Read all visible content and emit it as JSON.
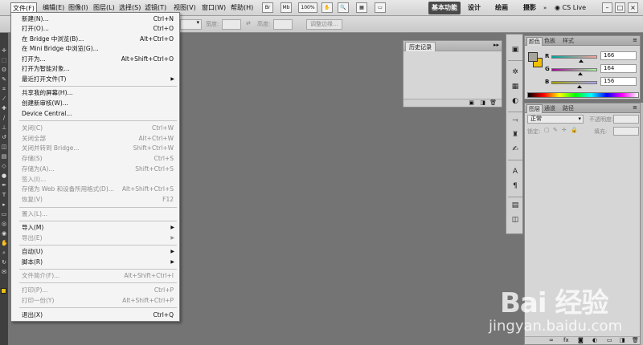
{
  "menubar": {
    "items": [
      "文件(F)",
      "编辑(E)",
      "图像(I)",
      "图层(L)",
      "选择(S)",
      "滤镜(T)",
      "视图(V)",
      "窗口(W)",
      "帮助(H)"
    ],
    "icons": [
      "Br",
      "Mb",
      "100%"
    ],
    "workspaces": [
      "基本功能",
      "设计",
      "绘画",
      "摄影"
    ],
    "cs_live": "CS Live",
    "window_controls": [
      "–",
      "□",
      "×"
    ]
  },
  "options_bar": {
    "width_label": "宽度:",
    "height_label": "高度:",
    "refine_edge": "调整边缘..."
  },
  "file_menu": {
    "items": [
      {
        "label": "新建(N)...",
        "shortcut": "Ctrl+N",
        "disabled": false
      },
      {
        "label": "打开(O)...",
        "shortcut": "Ctrl+O",
        "disabled": false
      },
      {
        "label": "在 Bridge 中浏览(B)...",
        "shortcut": "Alt+Ctrl+O",
        "disabled": false
      },
      {
        "label": "在 Mini Bridge 中浏览(G)...",
        "shortcut": "",
        "disabled": false
      },
      {
        "label": "打开为...",
        "shortcut": "Alt+Shift+Ctrl+O",
        "disabled": false
      },
      {
        "label": "打开为智能对象...",
        "shortcut": "",
        "disabled": false
      },
      {
        "label": "最近打开文件(T)",
        "shortcut": "",
        "disabled": false,
        "submenu": true
      },
      {
        "label": "共享我的屏幕(H)...",
        "shortcut": "",
        "disabled": false
      },
      {
        "label": "创建新审核(W)...",
        "shortcut": "",
        "disabled": false
      },
      {
        "label": "Device Central...",
        "shortcut": "",
        "disabled": false
      },
      {
        "label": "关闭(C)",
        "shortcut": "Ctrl+W",
        "disabled": true
      },
      {
        "label": "关闭全部",
        "shortcut": "Alt+Ctrl+W",
        "disabled": true
      },
      {
        "label": "关闭并转到 Bridge...",
        "shortcut": "Shift+Ctrl+W",
        "disabled": true
      },
      {
        "label": "存储(S)",
        "shortcut": "Ctrl+S",
        "disabled": true
      },
      {
        "label": "存储为(A)...",
        "shortcut": "Shift+Ctrl+S",
        "disabled": true
      },
      {
        "label": "签入(I)...",
        "shortcut": "",
        "disabled": true
      },
      {
        "label": "存储为 Web 和设备所用格式(D)...",
        "shortcut": "Alt+Shift+Ctrl+S",
        "disabled": true
      },
      {
        "label": "恢复(V)",
        "shortcut": "F12",
        "disabled": true
      },
      {
        "label": "置入(L)...",
        "shortcut": "",
        "disabled": true
      },
      {
        "label": "导入(M)",
        "shortcut": "",
        "disabled": false,
        "submenu": true
      },
      {
        "label": "导出(E)",
        "shortcut": "",
        "disabled": true,
        "submenu": true
      },
      {
        "label": "自动(U)",
        "shortcut": "",
        "disabled": false,
        "submenu": true
      },
      {
        "label": "脚本(R)",
        "shortcut": "",
        "disabled": false,
        "submenu": true
      },
      {
        "label": "文件简介(F)...",
        "shortcut": "Alt+Shift+Ctrl+I",
        "disabled": true
      },
      {
        "label": "打印(P)...",
        "shortcut": "Ctrl+P",
        "disabled": true
      },
      {
        "label": "打印一份(Y)",
        "shortcut": "Alt+Shift+Ctrl+P",
        "disabled": true
      },
      {
        "label": "退出(X)",
        "shortcut": "Ctrl+Q",
        "disabled": false
      }
    ]
  },
  "history_panel": {
    "tab": "历史记录",
    "collapse": "▸▸"
  },
  "color_panel": {
    "tabs": [
      "颜色",
      "色板",
      "样式"
    ],
    "channels": [
      {
        "name": "R",
        "value": "166",
        "fraction": 0.65
      },
      {
        "name": "G",
        "value": "164",
        "fraction": 0.64
      },
      {
        "name": "B",
        "value": "156",
        "fraction": 0.61
      }
    ],
    "fg_color": "#a6a49c",
    "bg_color": "#f0c000"
  },
  "layers_panel": {
    "tabs": [
      "图层",
      "通道",
      "路径"
    ],
    "blend_mode": "正常",
    "opacity_label": "不透明度:",
    "lock_label": "锁定:",
    "fill_label": "填充:"
  },
  "watermark": {
    "logo": "Bai 经验",
    "url": "jingyan.baidu.com"
  }
}
